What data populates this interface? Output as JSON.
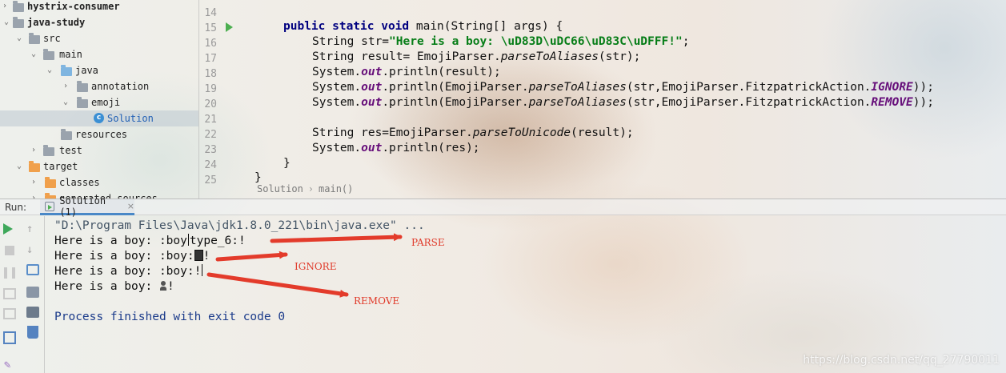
{
  "project_tree": {
    "items": [
      {
        "label": "hystrix-consumer",
        "icon": "module-folder-icon",
        "expanded": false
      },
      {
        "label": "java-study",
        "icon": "module-folder-icon",
        "expanded": true
      },
      {
        "label": "src",
        "icon": "folder-icon",
        "expanded": true
      },
      {
        "label": "main",
        "icon": "folder-icon",
        "expanded": true
      },
      {
        "label": "java",
        "icon": "source-folder-icon",
        "expanded": true
      },
      {
        "label": "annotation",
        "icon": "package-icon",
        "expanded": false
      },
      {
        "label": "emoji",
        "icon": "package-icon",
        "expanded": true
      },
      {
        "label": "Solution",
        "icon": "class-icon",
        "selected": true
      },
      {
        "label": "resources",
        "icon": "resources-folder-icon"
      },
      {
        "label": "test",
        "icon": "folder-icon",
        "expanded": false
      },
      {
        "label": "target",
        "icon": "excluded-folder-icon",
        "expanded": true
      },
      {
        "label": "classes",
        "icon": "excluded-folder-icon",
        "expanded": false
      },
      {
        "label": "generated-sources",
        "icon": "excluded-folder-icon",
        "expanded": false
      }
    ]
  },
  "editor": {
    "line_numbers": [
      "14",
      "15",
      "16",
      "17",
      "18",
      "19",
      "20",
      "21",
      "22",
      "23",
      "24",
      "25"
    ],
    "lines": {
      "l15_kw": "public static void",
      "l15_rest": " main(String[] args) {",
      "l16_a": "String str=",
      "l16_str": "\"Here is a boy: \\uD83D\\uDC66\\uD83C\\uDFFF!\"",
      "l16_end": ";",
      "l17_a": "String result= EmojiParser.",
      "l17_m": "parseToAliases",
      "l17_end": "(str);",
      "l18_a": "System.",
      "l18_f": "out",
      "l18_end": ".println(result);",
      "l19_a": "System.",
      "l19_f": "out",
      "l19_b": ".println(EmojiParser.",
      "l19_m": "parseToAliases",
      "l19_c": "(str,EmojiParser.FitzpatrickAction.",
      "l19_k": "IGNORE",
      "l19_end": "));",
      "l20_a": "System.",
      "l20_f": "out",
      "l20_b": ".println(EmojiParser.",
      "l20_m": "parseToAliases",
      "l20_c": "(str,EmojiParser.FitzpatrickAction.",
      "l20_k": "REMOVE",
      "l20_end": "));",
      "l22_a": "String res=EmojiParser.",
      "l22_m": "parseToUnicode",
      "l22_end": "(result);",
      "l23_a": "System.",
      "l23_f": "out",
      "l23_end": ".println(res);",
      "l24": "}",
      "l25": "}"
    }
  },
  "breadcrumb": {
    "items": [
      "Solution",
      "main()"
    ]
  },
  "run_panel": {
    "label": "Run:",
    "tab_label": "Solution (1)",
    "tab_close": "×"
  },
  "console": {
    "command": "\"D:\\Program Files\\Java\\jdk1.8.0_221\\bin\\java.exe\" ...",
    "line1_a": "Here is a boy: :boy",
    "line1_b": "type_6:!",
    "line2_a": "Here is a boy: :boy:",
    "line2_b": "!",
    "line3_a": "Here is a boy: :boy:!",
    "line4_a": "Here is a boy: ",
    "line4_b": "!",
    "exit": "Process finished with exit code 0"
  },
  "annotations": {
    "parse": "PARSE",
    "ignore": "IGNORE",
    "remove": "REMOVE",
    "color": "#e03a2a"
  },
  "watermark": "https://blog.csdn.net/qq_27790011"
}
